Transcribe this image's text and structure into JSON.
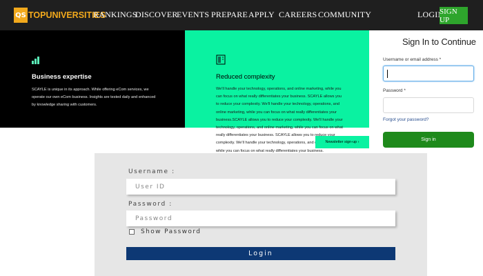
{
  "nav": {
    "logo_badge": "QS",
    "logo_text": "TOPUNIVERSITIES",
    "items": [
      "RANKINGS",
      "DISCOVER",
      "EVENTS",
      "PREPARE",
      "APPLY",
      "CAREERS",
      "COMMUNITY"
    ],
    "login": "LOGIN",
    "signup": "SIGN UP",
    "background": "#1f1f1f",
    "accent": "#f2a91c",
    "signup_color": "#2ea52c"
  },
  "feature_left": {
    "icon": "bar-chart-icon",
    "title": "Business expertise",
    "body": "SCAYLE is unique in its approach. While offering eCom services, we operate our own eCom business. Insights are tested daily and enhanced by knowledge sharing with customers.",
    "background": "#000000"
  },
  "feature_right": {
    "icon": "document-icon",
    "title": "Reduced complexity",
    "body": "We'll handle your technology, operations, and online marketing, while you can focus on what really differentiates your business. SCAYLE allows you to reduce your complexity. We'll handle your technology, operations, and online marketing, while you can focus on what really differentiates your business.SCAYLE allows you to reduce your complexity. We'll handle your technology, operations, and online marketing, while you can focus on what really differentiates your business. SCAYLE allows you to reduce your complexity. We'll handle your technology, operations, and online marketing, while you can focus on what really differentiates your business.",
    "newsletter": "Newsletter sign-up  ›",
    "background": "#0af2a1"
  },
  "signin": {
    "title": "Sign In to Continue",
    "username_label": "Username or email address *",
    "password_label": "Password *",
    "forgot": "Forgot your password?",
    "button": "Sign in",
    "button_color": "#1e8a1b"
  },
  "login_form": {
    "username_label": "Username :",
    "username_placeholder": "User ID",
    "password_label": "Password :",
    "password_placeholder": "Password",
    "show_password": "Show Password",
    "button": "Login",
    "button_color": "#0d3874",
    "background": "#e6e6e6"
  }
}
